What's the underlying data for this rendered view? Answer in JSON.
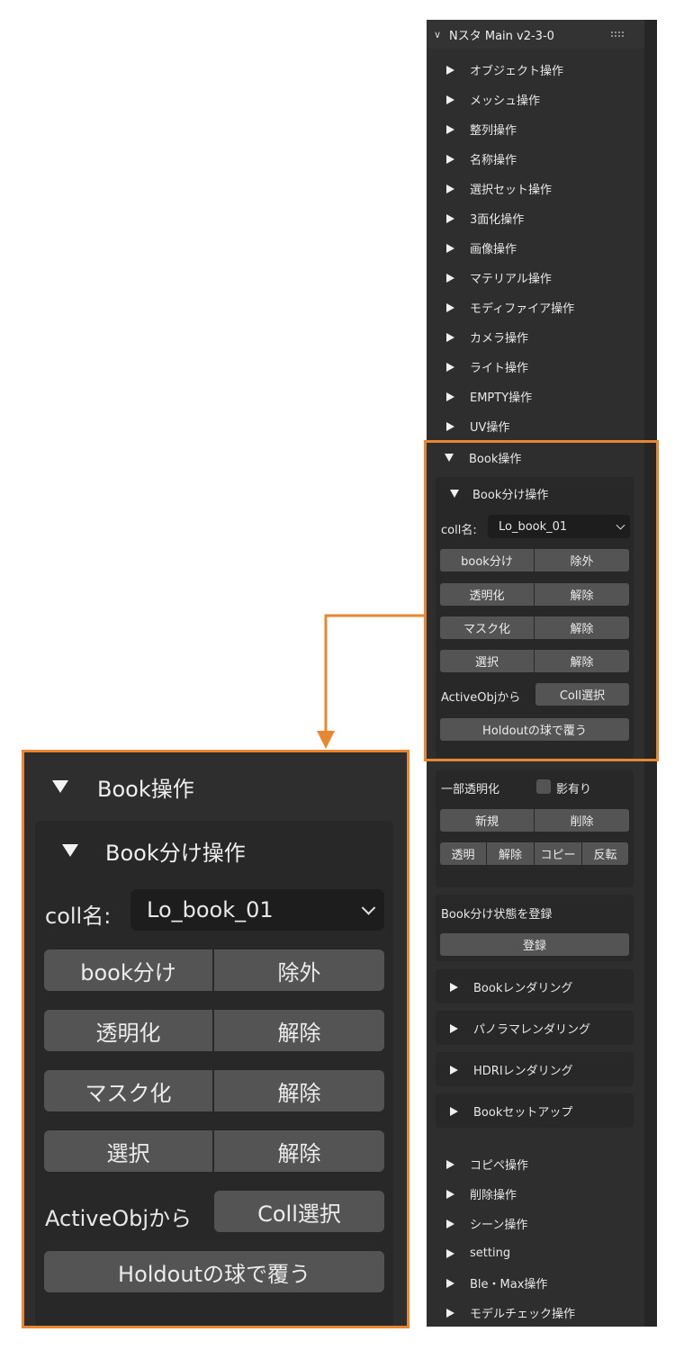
{
  "panel": {
    "title": "Nスタ Main v2-3-0",
    "menu_items": [
      "オブジェクト操作",
      "メッシュ操作",
      "整列操作",
      "名称操作",
      "選択セット操作",
      "3面化操作",
      "画像操作",
      "マテリアル操作",
      "モディファイア操作",
      "カメラ操作",
      "ライト操作",
      "EMPTY操作",
      "UV操作"
    ],
    "book_ops": {
      "title": "Book操作",
      "split": {
        "title": "Book分け操作",
        "coll_label": "coll名:",
        "coll_value": "Lo_book_01",
        "rows": [
          {
            "left": "book分け",
            "right": "除外"
          },
          {
            "left": "透明化",
            "right": "解除"
          },
          {
            "left": "マスク化",
            "right": "解除"
          },
          {
            "left": "選択",
            "right": "解除"
          }
        ],
        "active_label": "ActiveObjから",
        "coll_select": "Coll選択",
        "holdout": "Holdoutの球で覆う"
      }
    },
    "partial": {
      "label": "一部透明化",
      "shadow": "影有り",
      "new_btn": "新規",
      "delete_btn": "削除",
      "actions": [
        "透明",
        "解除",
        "コピー",
        "反転"
      ]
    },
    "register": {
      "label": "Book分け状態を登録",
      "button": "登録"
    },
    "sub_panels": [
      "Bookレンダリング",
      "パノラマレンダリング",
      "HDRIレンダリング",
      "Bookセットアップ"
    ],
    "bottom_items": [
      "コピペ操作",
      "削除操作",
      "シーン操作",
      "setting",
      "Ble・Max操作",
      "モデルチェック操作"
    ]
  },
  "colors": {
    "highlight": "#e98632",
    "panel_bg": "#2e2e2e",
    "button": "#545454"
  }
}
